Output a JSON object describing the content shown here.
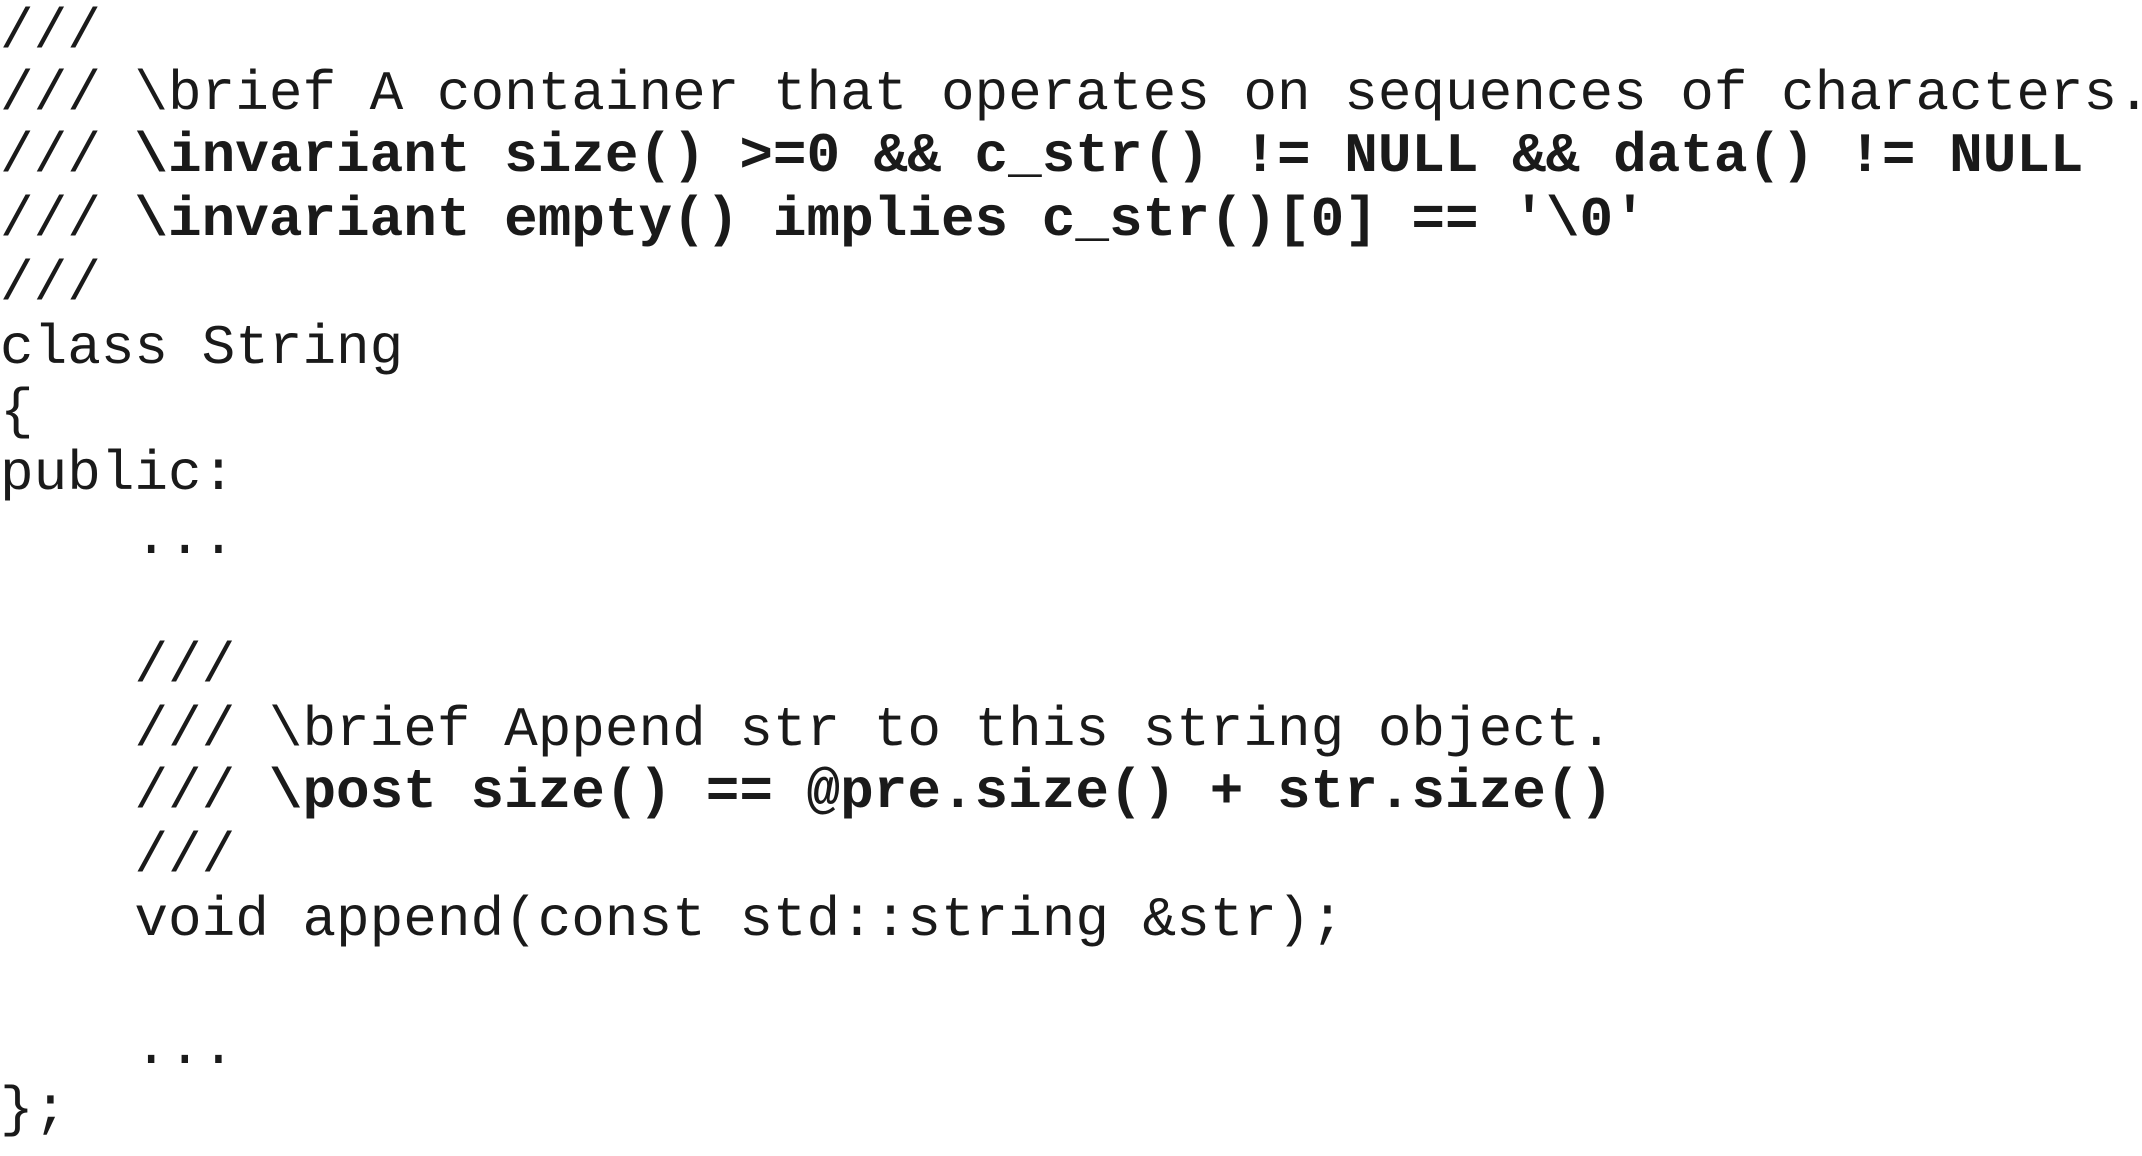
{
  "code": {
    "lines": [
      {
        "parts": [
          {
            "text": "///",
            "weight": "normal"
          }
        ]
      },
      {
        "parts": [
          {
            "text": "/// \\brief A container that operates on sequences of characters.",
            "weight": "normal"
          }
        ]
      },
      {
        "parts": [
          {
            "text": "/// ",
            "weight": "normal"
          },
          {
            "text": "\\invariant size() >=0 && c_str() != NULL && data() != NULL",
            "weight": "bold"
          }
        ]
      },
      {
        "parts": [
          {
            "text": "/// ",
            "weight": "normal"
          },
          {
            "text": "\\invariant empty() implies c_str()[0] == '\\0'",
            "weight": "bold"
          }
        ]
      },
      {
        "parts": [
          {
            "text": "///",
            "weight": "normal"
          }
        ]
      },
      {
        "parts": [
          {
            "text": "class String",
            "weight": "normal"
          }
        ]
      },
      {
        "parts": [
          {
            "text": "{",
            "weight": "normal"
          }
        ]
      },
      {
        "parts": [
          {
            "text": "public:",
            "weight": "normal"
          }
        ]
      },
      {
        "parts": [
          {
            "text": "    ...",
            "weight": "normal"
          }
        ]
      },
      {
        "parts": [
          {
            "text": "",
            "weight": "normal"
          }
        ]
      },
      {
        "parts": [
          {
            "text": "    ///",
            "weight": "normal"
          }
        ]
      },
      {
        "parts": [
          {
            "text": "    /// \\brief Append str to this string object.",
            "weight": "normal"
          }
        ]
      },
      {
        "parts": [
          {
            "text": "    /// ",
            "weight": "normal"
          },
          {
            "text": "\\post size() == @pre.size() + str.size()",
            "weight": "bold"
          }
        ]
      },
      {
        "parts": [
          {
            "text": "    ///",
            "weight": "normal"
          }
        ]
      },
      {
        "parts": [
          {
            "text": "    void append(const std::string &str);",
            "weight": "normal"
          }
        ]
      },
      {
        "parts": [
          {
            "text": "",
            "weight": "normal"
          }
        ]
      },
      {
        "parts": [
          {
            "text": "    ...",
            "weight": "normal"
          }
        ]
      },
      {
        "parts": [
          {
            "text": "};",
            "weight": "normal"
          }
        ]
      }
    ]
  }
}
